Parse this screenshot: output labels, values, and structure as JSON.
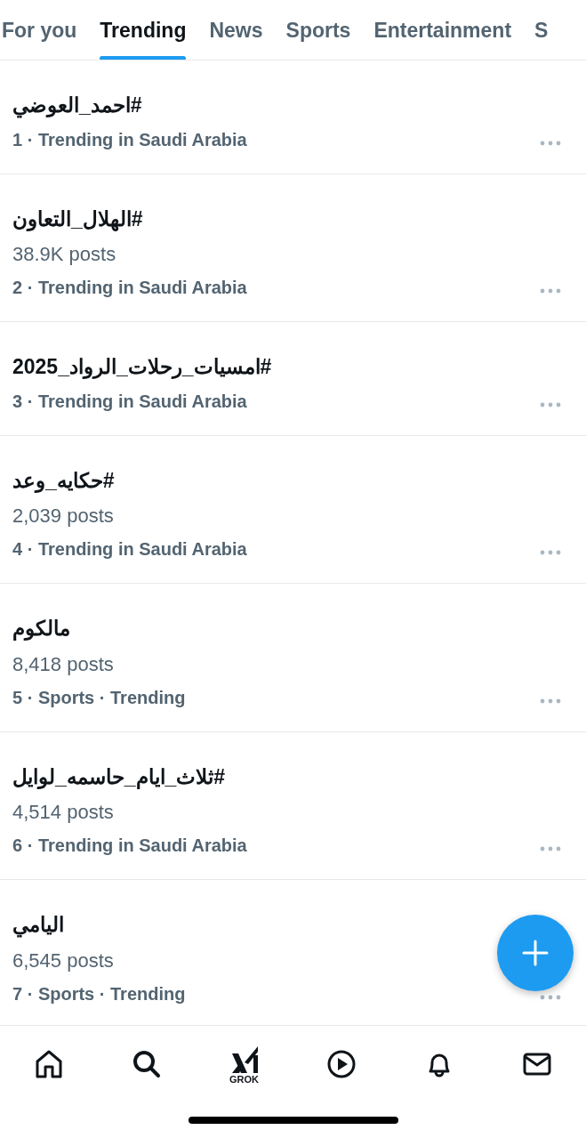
{
  "tabs": [
    {
      "label": "For you",
      "selected": false
    },
    {
      "label": "Trending",
      "selected": true
    },
    {
      "label": "News",
      "selected": false
    },
    {
      "label": "Sports",
      "selected": false
    },
    {
      "label": "Entertainment",
      "selected": false
    },
    {
      "label": "S",
      "selected": false
    }
  ],
  "trends": [
    {
      "title": "#احمد_العوضي",
      "meta": "1 · Trending in Saudi Arabia"
    },
    {
      "title": "#الهلال_التعاون",
      "posts": "38.9K posts",
      "meta": "2 · Trending in Saudi Arabia"
    },
    {
      "title": "#امسيات_رحلات_الرواد_2025",
      "meta": "3 · Trending in Saudi Arabia"
    },
    {
      "title": "#حكايه_وعد",
      "posts": "2,039 posts",
      "meta": "4 · Trending in Saudi Arabia"
    },
    {
      "title": "مالكوم",
      "posts": "8,418 posts",
      "meta": "5 · Sports · Trending"
    },
    {
      "title": "#ثلاث_ايام_حاسمه_لوايل",
      "posts": "4,514 posts",
      "meta": "6 · Trending in Saudi Arabia"
    },
    {
      "title": "اليامي",
      "posts": "6,545 posts",
      "meta": "7 · Sports · Trending"
    }
  ],
  "nav": [
    {
      "kind": "home"
    },
    {
      "kind": "search"
    },
    {
      "kind": "grok",
      "label": "GROK"
    },
    {
      "kind": "play"
    },
    {
      "kind": "bell"
    },
    {
      "kind": "mail"
    }
  ]
}
